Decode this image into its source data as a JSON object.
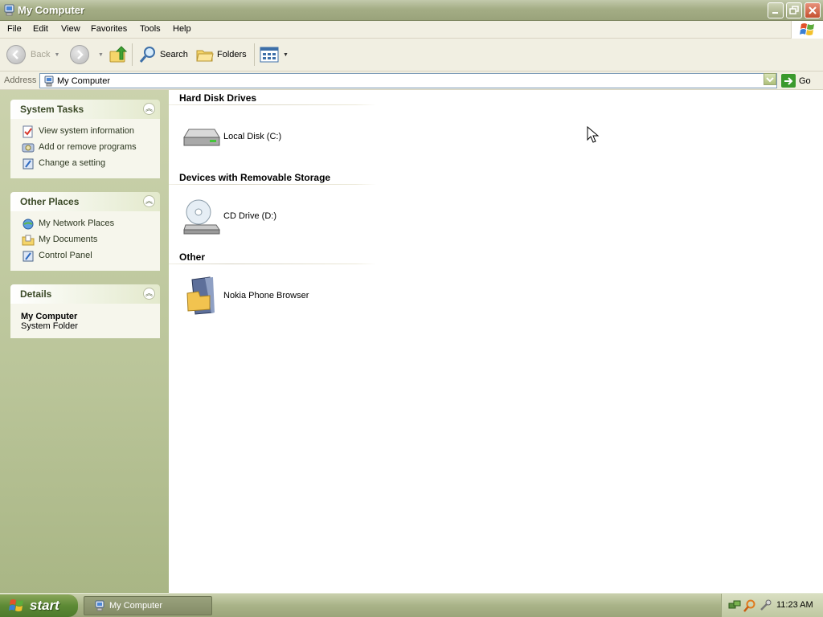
{
  "window": {
    "title": "My Computer",
    "icon": "my-computer-icon",
    "controls": [
      "minimize-icon",
      "restore-icon",
      "close-icon"
    ]
  },
  "menu": {
    "items": [
      "File",
      "Edit",
      "View",
      "Favorites",
      "Tools",
      "Help"
    ]
  },
  "toolbar": {
    "back_label": "Back",
    "search_label": "Search",
    "folders_label": "Folders"
  },
  "address": {
    "label": "Address",
    "value": "My Computer",
    "go_label": "Go"
  },
  "taskpane": {
    "system_tasks": {
      "title": "System Tasks",
      "items": [
        {
          "label": "View system information",
          "icon": "system-info-icon"
        },
        {
          "label": "Add or remove programs",
          "icon": "add-remove-programs-icon"
        },
        {
          "label": "Change a setting",
          "icon": "control-panel-icon"
        }
      ]
    },
    "other_places": {
      "title": "Other Places",
      "items": [
        {
          "label": "My Network Places",
          "icon": "network-places-icon"
        },
        {
          "label": "My Documents",
          "icon": "my-documents-icon"
        },
        {
          "label": "Control Panel",
          "icon": "control-panel-icon"
        }
      ]
    },
    "details": {
      "title": "Details",
      "name": "My Computer",
      "type": "System Folder"
    }
  },
  "content": {
    "groups": [
      {
        "title": "Hard Disk Drives",
        "items": [
          {
            "label": "Local Disk (C:)",
            "icon": "hard-disk-icon"
          }
        ]
      },
      {
        "title": "Devices with Removable Storage",
        "items": [
          {
            "label": "CD Drive (D:)",
            "icon": "cd-drive-icon"
          }
        ]
      },
      {
        "title": "Other",
        "items": [
          {
            "label": "Nokia Phone Browser",
            "icon": "phone-browser-icon"
          }
        ]
      }
    ]
  },
  "taskbar": {
    "start_label": "start",
    "open_window": "My Computer",
    "clock": "11:23 AM"
  },
  "colors": {
    "title_bar": "#a4ad85",
    "task_pane": "#b9c498",
    "start_button": "#5d8a35",
    "content_bg": "#ffffff"
  }
}
